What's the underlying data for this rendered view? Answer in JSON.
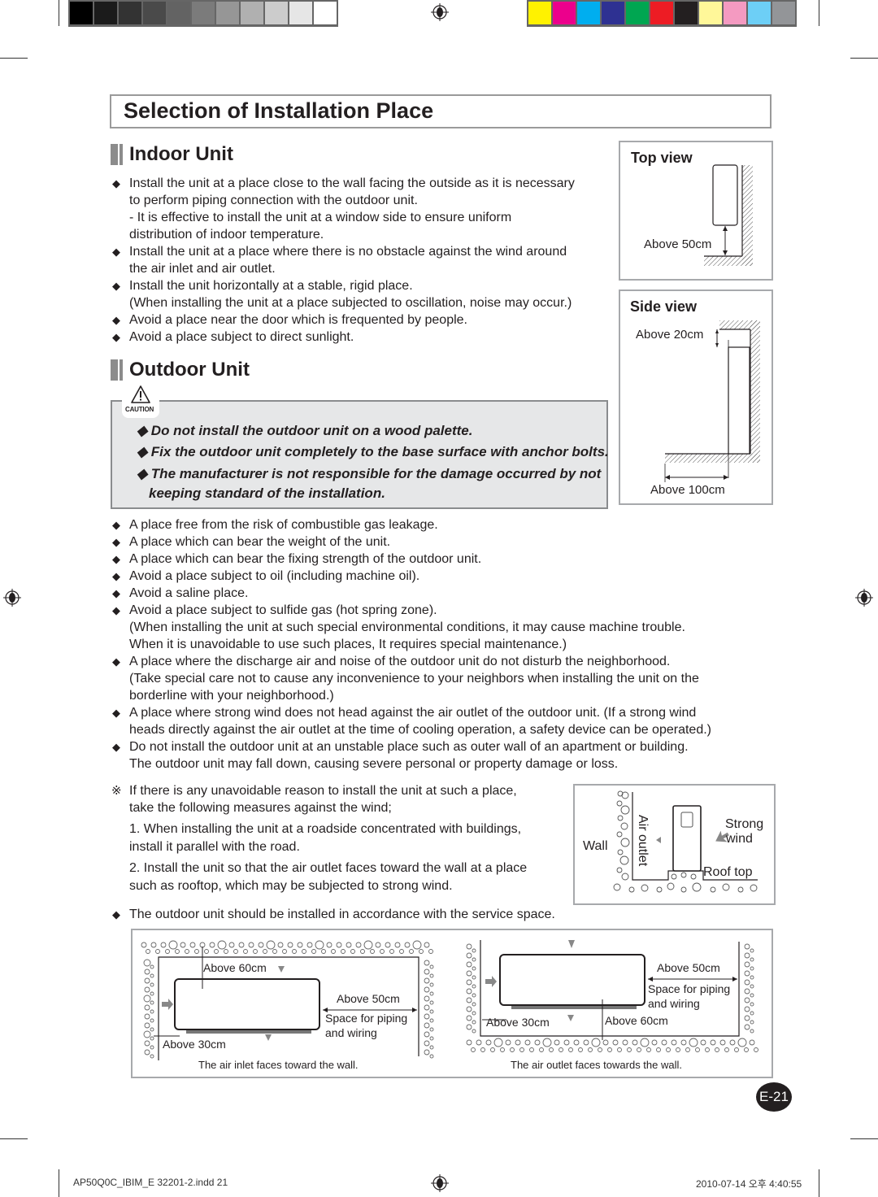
{
  "print_marks": {
    "gray_swatches": [
      "#000000",
      "#1b1b1b",
      "#333333",
      "#4a4a4a",
      "#636363",
      "#7b7b7b",
      "#969696",
      "#b0b0b0",
      "#cccccc",
      "#e6e6e6",
      "#ffffff"
    ],
    "color_swatches": [
      "#fff200",
      "#ec008c",
      "#00aeef",
      "#2e3192",
      "#00a651",
      "#ed1c24",
      "#231f20",
      "#fff799",
      "#f49ac1",
      "#6dcff6",
      "#939598"
    ]
  },
  "page_title": "Selection of Installation Place",
  "indoor": {
    "heading": "Indoor Unit",
    "lines": [
      {
        "bullet": true,
        "text": "Install the unit at a place close to the wall facing the outside as it is necessary"
      },
      {
        "bullet": false,
        "text": "to perform piping connection with the outdoor unit."
      },
      {
        "bullet": false,
        "text": "- It is effective to install the unit at a window side to ensure uniform"
      },
      {
        "bullet": false,
        "text": " distribution of indoor temperature."
      },
      {
        "bullet": true,
        "text": "Install the unit at a place where there is no obstacle against the wind around"
      },
      {
        "bullet": false,
        "text": "the air inlet and air outlet."
      },
      {
        "bullet": true,
        "text": "Install the unit horizontally at a stable, rigid place."
      },
      {
        "bullet": false,
        "text": "(When installing the unit at a place subjected to oscillation, noise may occur.)"
      },
      {
        "bullet": true,
        "text": "Avoid a place near the door which is frequented by people."
      },
      {
        "bullet": true,
        "text": "Avoid a place subject to direct sunlight."
      }
    ]
  },
  "top_view": {
    "title": "Top view",
    "label": "Above 50cm"
  },
  "side_view": {
    "title": "Side view",
    "label_top": "Above 20cm",
    "label_bottom": "Above 100cm"
  },
  "outdoor": {
    "heading": "Outdoor Unit",
    "caution_label": "CAUTION",
    "caution_lines": [
      "◆ Do not install the outdoor unit on a wood palette.",
      "◆ Fix the outdoor unit completely to the base surface with anchor bolts.",
      "◆ The manufacturer is not responsible for the damage occurred by not",
      "keeping standard of the installation."
    ],
    "lines": [
      {
        "bullet": true,
        "text": "A place free from the risk of combustible gas leakage."
      },
      {
        "bullet": true,
        "text": "A place which can bear the weight of the unit."
      },
      {
        "bullet": true,
        "text": "A place which can bear the fixing strength of the outdoor unit."
      },
      {
        "bullet": true,
        "text": "Avoid a place subject to oil (including machine oil)."
      },
      {
        "bullet": true,
        "text": "Avoid a saline place."
      },
      {
        "bullet": true,
        "text": "Avoid a place subject to sulfide gas (hot spring zone)."
      },
      {
        "bullet": false,
        "text": "(When installing the unit at such special environmental conditions, it may cause machine trouble."
      },
      {
        "bullet": false,
        "text": " When it is unavoidable to use such places, It requires special maintenance.)"
      },
      {
        "bullet": true,
        "text": "A place where the discharge air and noise of the outdoor unit do not disturb the neighborhood."
      },
      {
        "bullet": false,
        "text": "(Take special care not to cause any inconvenience to your neighbors when installing the unit on the"
      },
      {
        "bullet": false,
        "text": "borderline with your neighborhood.)"
      },
      {
        "bullet": true,
        "text": "A place where strong wind does not head against the air outlet of the outdoor unit. (If a strong wind"
      },
      {
        "bullet": false,
        "text": "heads directly against the air outlet at the time of cooling operation, a safety device can be operated.)"
      },
      {
        "bullet": true,
        "text": "Do not install the outdoor unit at an unstable place such as outer wall of an apartment or building."
      },
      {
        "bullet": false,
        "text": "The outdoor unit may fall down, causing severe personal or property damage or loss."
      }
    ],
    "note_symbol": "※",
    "note_lines": [
      "If there is any unavoidable reason to install the unit at such a place,",
      "take the following measures against the wind;",
      "1. When installing the unit at a roadside concentrated with buildings,",
      "  install it parallel with the road.",
      "2. Install the unit so that the air outlet faces toward the wall at a place",
      "  such as rooftop, which may be subjected to strong wind."
    ],
    "service_space_line": "The outdoor unit should be installed in accordance with the service space."
  },
  "wind_diagram": {
    "wall": "Wall",
    "air_outlet": "Air outlet",
    "strong": "Strong",
    "wind": "wind",
    "roof_top": "Roof top"
  },
  "service_left": {
    "top": "Above 60cm",
    "right": "Above 50cm",
    "piping1": "Space for piping",
    "piping2": "and wiring",
    "left": "Above 30cm",
    "caption": "The air inlet faces toward the wall."
  },
  "service_right": {
    "right": "Above 50cm",
    "piping1": "Space for piping",
    "piping2": "and wiring",
    "left": "Above 30cm",
    "bottom": "Above 60cm",
    "caption": "The air outlet faces towards the wall."
  },
  "page_number": "E-21",
  "footer": {
    "file": "AP50Q0C_IBIM_E 32201-2.indd   21",
    "timestamp": "2010-07-14   오후 4:40:55"
  }
}
